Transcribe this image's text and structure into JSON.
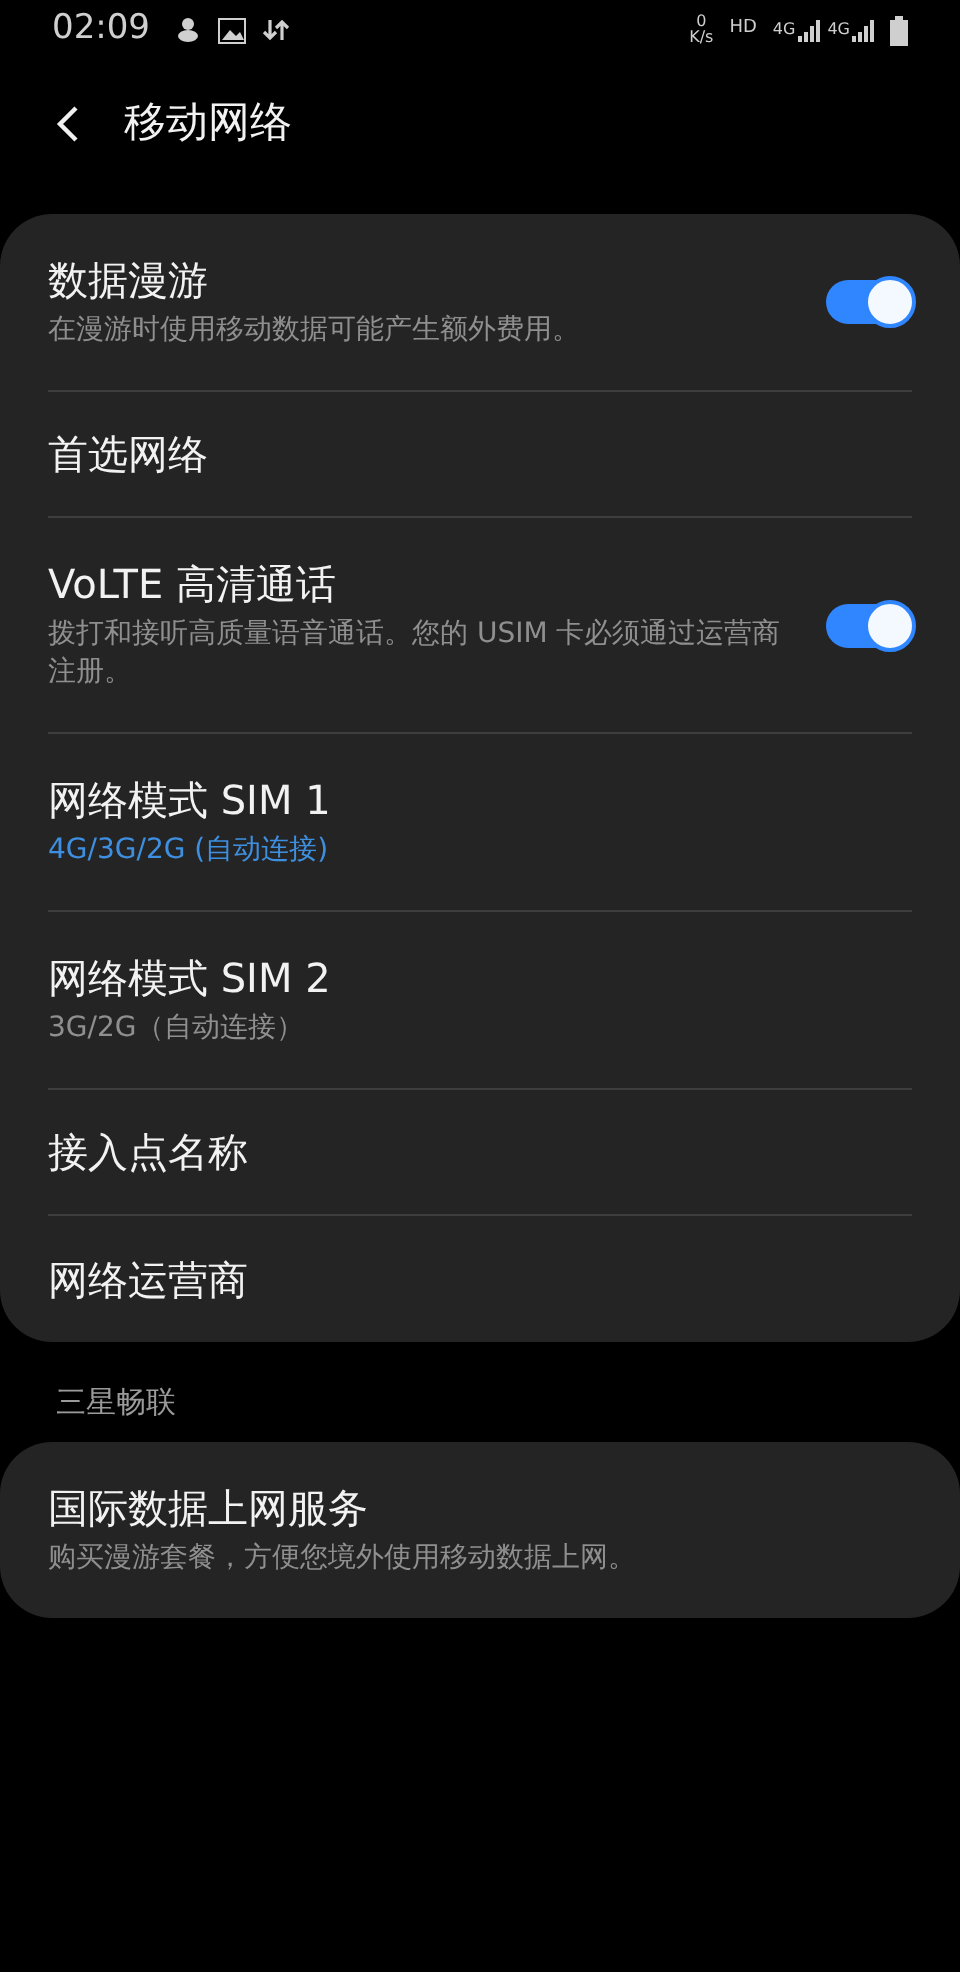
{
  "status_bar": {
    "time": "02:09",
    "speed_value": "0",
    "speed_unit": "K/s",
    "hd": "HD",
    "sim1_network": "4G",
    "sim2_network": "4G"
  },
  "header": {
    "title": "移动网络"
  },
  "settings": [
    {
      "kind": "toggle",
      "title": "数据漫游",
      "subtitle": "在漫游时使用移动数据可能产生额外费用。",
      "on": true
    },
    {
      "kind": "plain",
      "title": "首选网络"
    },
    {
      "kind": "toggle",
      "title": "VoLTE 高清通话",
      "subtitle": "拨打和接听高质量语音通话。您的 USIM 卡必须通过运营商注册。",
      "on": true
    },
    {
      "kind": "plain",
      "title": "网络模式 SIM 1",
      "subtitle": "4G/3G/2G (自动连接)",
      "accent": true
    },
    {
      "kind": "plain",
      "title": "网络模式 SIM 2",
      "subtitle": "3G/2G（自动连接）",
      "accent": false
    },
    {
      "kind": "plain",
      "title": "接入点名称"
    },
    {
      "kind": "plain",
      "title": "网络运营商"
    }
  ],
  "section": {
    "title": "三星畅联",
    "items": [
      {
        "title": "国际数据上网服务",
        "subtitle": "购买漫游套餐，方便您境外使用移动数据上网。"
      }
    ]
  }
}
